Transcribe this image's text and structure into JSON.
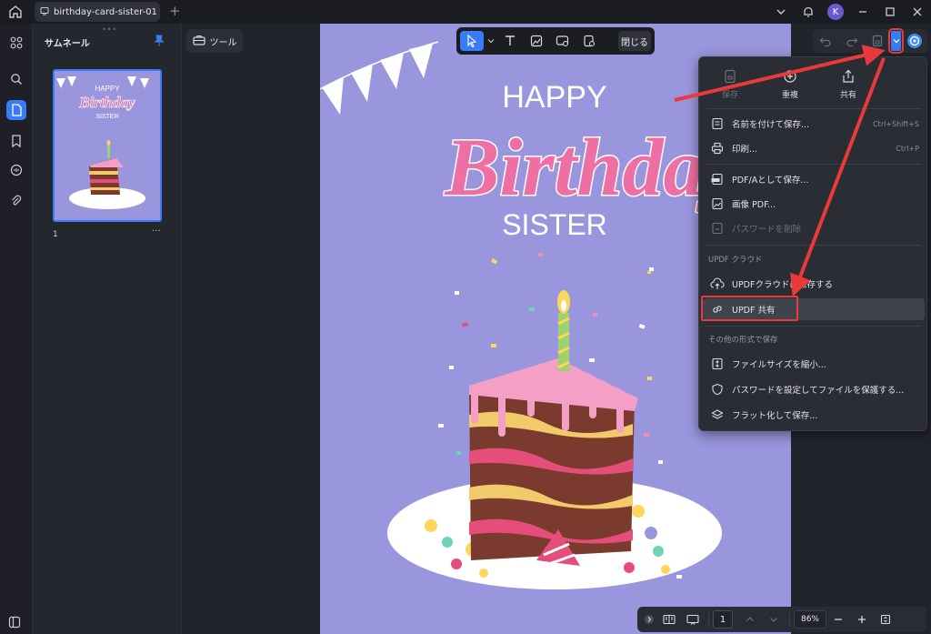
{
  "titlebar": {
    "tab_title": "birthday-card-sister-01",
    "avatar_letter": "K"
  },
  "thumbnails": {
    "title": "サムネール",
    "page_number": "1",
    "more": "···",
    "mini_happy": "HAPPY",
    "mini_birthday": "Birthday",
    "mini_sister": "SISTER"
  },
  "main": {
    "tool_label": "ツール",
    "close_label": "閉じる"
  },
  "card": {
    "happy": "HAPPY",
    "birthday": "Birthday",
    "sister": "SISTER"
  },
  "menu": {
    "quick_actions": [
      {
        "label": "保存",
        "disabled": true
      },
      {
        "label": "重複",
        "disabled": false
      },
      {
        "label": "共有",
        "disabled": false
      }
    ],
    "save_as": "名前を付けて保存...",
    "save_as_shortcut": "Ctrl+Shift+S",
    "print": "印刷...",
    "print_shortcut": "Ctrl+P",
    "save_pdfa": "PDF/Aとして保存...",
    "image_pdf": "画像 PDF...",
    "remove_password": "パスワードを削除",
    "section_cloud": "UPDF クラウド",
    "save_to_cloud": "UPDFクラウドに保存する",
    "updf_share": "UPDF 共有",
    "section_other": "その他の形式で保存",
    "reduce_size": "ファイルサイズを縮小...",
    "protect_password": "パスワードを設定してファイルを保護する...",
    "flatten_save": "フラット化して保存..."
  },
  "bottombar": {
    "page_input": "1",
    "zoom": "86%"
  },
  "colors": {
    "accent": "#3a7bf7",
    "highlight": "#e8393b",
    "card_bg": "#9a96de"
  }
}
